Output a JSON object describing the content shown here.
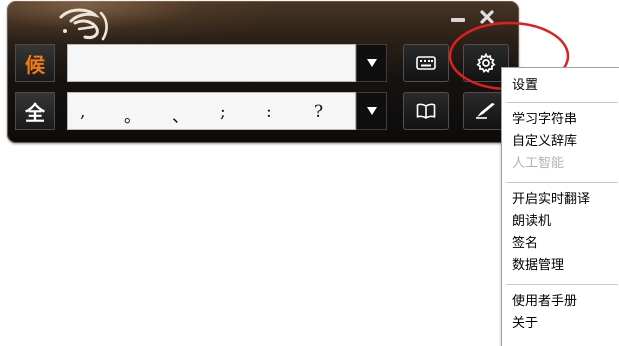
{
  "window": {
    "minimize_icon": "minimize-icon",
    "close_icon": "close-icon"
  },
  "row1": {
    "mode_label": "候",
    "candidate_text": "",
    "dropdown_icon": "triangle-down-icon",
    "keyboard_icon": "keyboard-icon",
    "settings_icon": "gear-icon"
  },
  "row2": {
    "mode_label": "全",
    "punctuation": [
      ",",
      "。",
      "、",
      ";",
      ":",
      "?"
    ],
    "dropdown_icon": "triangle-down-icon",
    "dictionary_icon": "book-icon",
    "handwriting_icon": "pen-icon"
  },
  "menu": {
    "items": [
      {
        "label": "设置",
        "enabled": true
      },
      {
        "label": "学习字符串",
        "enabled": true
      },
      {
        "label": "自定义辞库",
        "enabled": true
      },
      {
        "label": "人工智能",
        "enabled": false
      },
      {
        "label": "开启实时翻译",
        "enabled": true
      },
      {
        "label": "朗读机",
        "enabled": true
      },
      {
        "label": "签名",
        "enabled": true
      },
      {
        "label": "数据管理",
        "enabled": true
      },
      {
        "label": "使用者手册",
        "enabled": true
      },
      {
        "label": "关于",
        "enabled": true
      }
    ]
  },
  "colors": {
    "accent_orange": "#f07a16",
    "annotation_red": "#e02020",
    "toolbar_dark": "#151210",
    "disabled_text": "#b4b4b4"
  }
}
